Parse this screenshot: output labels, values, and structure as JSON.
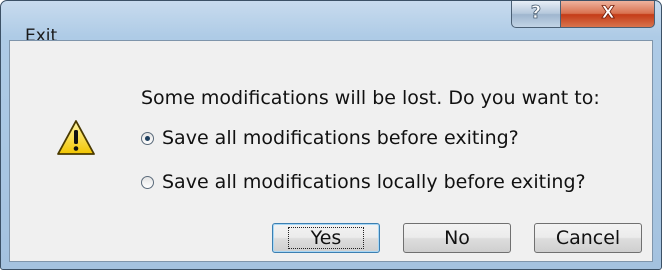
{
  "window": {
    "title": "Exit"
  },
  "caption": {
    "help_symbol": "?",
    "close_symbol": "X"
  },
  "dialog": {
    "message": "Some modifications will be lost. Do you want to:",
    "options": [
      {
        "label": "Save all modifications before exiting?",
        "checked": true
      },
      {
        "label": "Save all modifications locally before exiting?",
        "checked": false
      }
    ]
  },
  "buttons": {
    "yes": "Yes",
    "no": "No",
    "cancel": "Cancel"
  },
  "icons": {
    "warning": "warning-icon"
  }
}
